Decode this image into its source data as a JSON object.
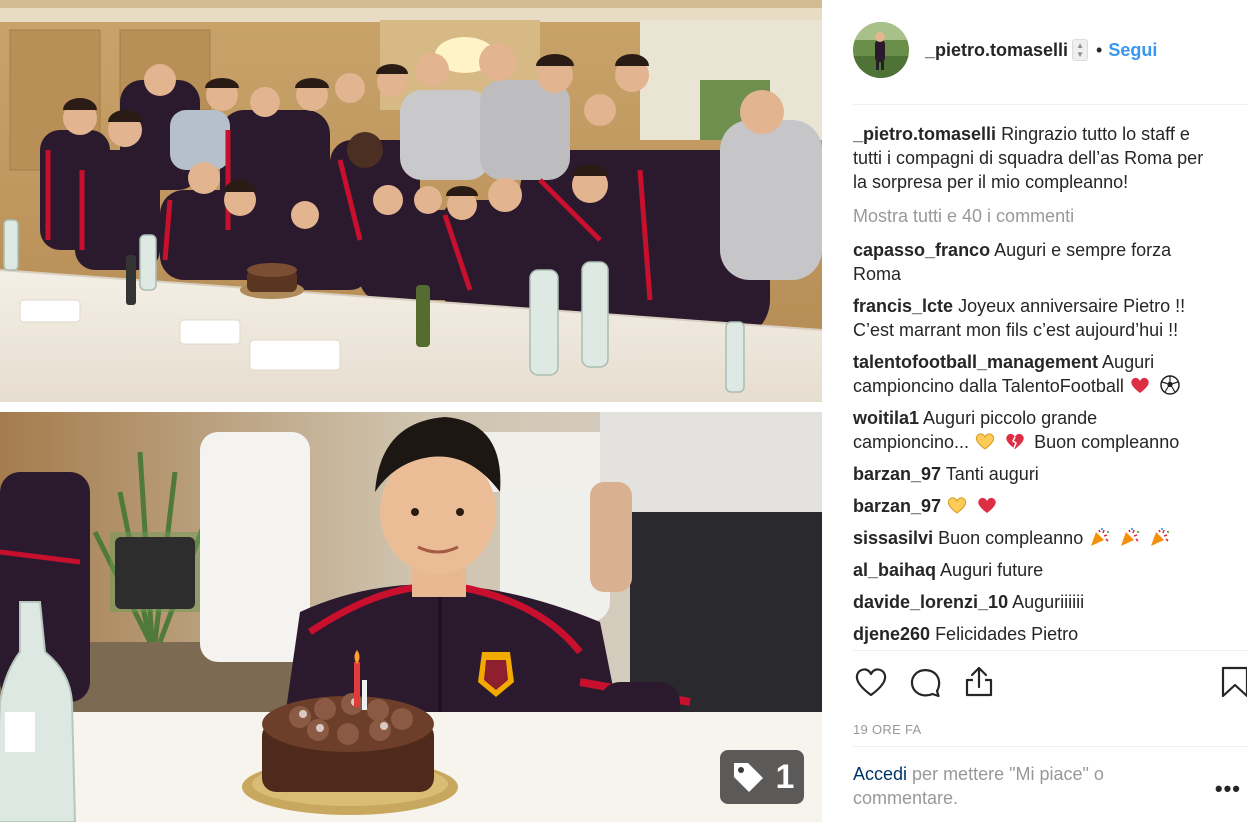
{
  "post": {
    "username": "_pietro.tomaselli",
    "spinner": {
      "up": "▲",
      "down": "▼"
    },
    "dot": "•",
    "follow_label": "Segui",
    "caption": "Ringrazio tutto lo staff e tutti i compagni di squadra dell’as Roma per la sorpresa per il mio compleanno!",
    "view_all_comments": "Mostra tutti e 40 i commenti",
    "tag_count": "1",
    "timestamp": "19 ORE FA"
  },
  "comments": [
    {
      "user": "capasso_franco",
      "text": "Auguri e sempre forza Roma"
    },
    {
      "user": "francis_lcte",
      "text": "Joyeux anniversaire Pietro !! C’est marrant mon fils c’est aujourd’hui !!"
    },
    {
      "user": "talentofootball_management",
      "text": "Auguri campioncino dalla TalentoFootball",
      "emojis": [
        "red-heart",
        "soccer-ball"
      ]
    },
    {
      "user": "woitila1",
      "text": "Auguri piccolo grande campioncino...",
      "emojis": [
        "yellow-heart",
        "broken-heart"
      ],
      "text_after": "Buon compleanno"
    },
    {
      "user": "barzan_97",
      "text": "Tanti auguri"
    },
    {
      "user": "barzan_97",
      "text": "",
      "emojis": [
        "yellow-heart",
        "red-heart"
      ]
    },
    {
      "user": "sissasilvi",
      "text": "Buon compleanno",
      "emojis": [
        "party-popper",
        "party-popper",
        "party-popper"
      ]
    },
    {
      "user": "al_baihaq",
      "text": "Auguri future"
    },
    {
      "user": "davide_lorenzi_10",
      "text": "Auguriiiiii"
    },
    {
      "user": "djene260",
      "text": "Felicidades Pietro"
    }
  ],
  "login": {
    "link": "Accedi",
    "text": "per mettere \"Mi piace\" o commentare."
  },
  "more_options": "•••",
  "icons": {
    "like": "heart-outline-icon",
    "comment": "speech-bubble-icon",
    "share": "share-upload-icon",
    "save": "bookmark-icon",
    "tag": "price-tag-icon"
  },
  "colors": {
    "follow": "#3897f0",
    "secondary_text": "#999999",
    "login_link": "#003569",
    "jersey": "#2b1a2e",
    "jersey_stripe": "#c8102e"
  }
}
